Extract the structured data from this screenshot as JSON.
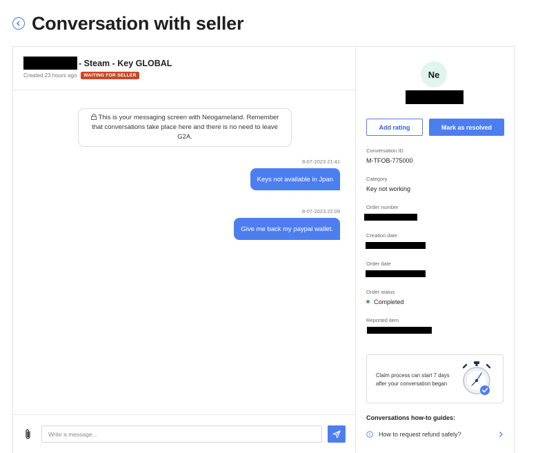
{
  "page": {
    "title": "Conversation with seller"
  },
  "chat": {
    "product_title_suffix": "- Steam - Key GLOBAL",
    "created": "Created 23 hours ago",
    "status_badge": "WAITING FOR SELLER",
    "info_notice": "This is your messaging screen with Neogameland. Remember that conversations take place here and there is no need to leave G2A.",
    "messages": [
      {
        "time": "8-07-2023 21:41",
        "text": "Keys not available in Jpan"
      },
      {
        "time": "8-07-2023 22:09",
        "text": "Give me back my paypal wallet."
      }
    ],
    "composer_placeholder": "Write a message..."
  },
  "sidebar": {
    "avatar_initials": "Ne",
    "add_rating": "Add rating",
    "mark_resolved": "Mark as resolved",
    "conversation_id_label": "Conversation ID",
    "conversation_id": "M-TFOB-775000",
    "category_label": "Category",
    "category": "Key not working",
    "order_number_label": "Order number",
    "creation_date_label": "Creation date",
    "order_date_label": "Order date",
    "order_status_label": "Order status",
    "order_status": "Completed",
    "reported_item_label": "Reported item",
    "claim_text": "Claim process can start 7 days after your conversation began",
    "guides_title": "Conversations how-to guides:",
    "guides": [
      {
        "label": "How to request refund safely?"
      }
    ]
  },
  "colors": {
    "accent": "#4d7ef0",
    "badge": "#c8492b",
    "status_ok": "#46b049",
    "avatar_bg": "#dff5ee"
  },
  "icons": [
    "back-arrow-icon",
    "lock-icon",
    "paperclip-icon",
    "send-icon",
    "stopwatch-icon",
    "info-icon",
    "chevron-right-icon"
  ]
}
